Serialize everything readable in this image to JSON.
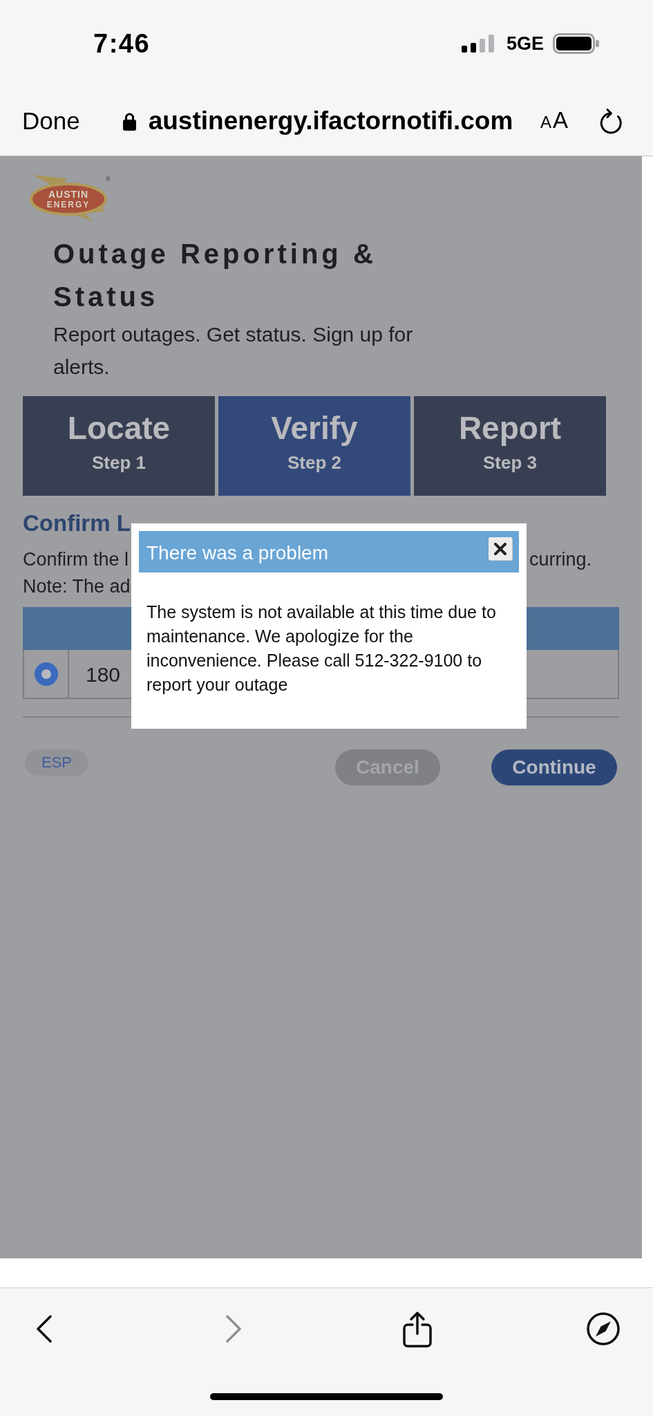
{
  "status_bar": {
    "time": "7:46",
    "network": "5GE"
  },
  "browser_bar": {
    "done": "Done",
    "url": "austinenergy.ifactornotifi.com",
    "text_size": "AA"
  },
  "page": {
    "logo": {
      "lines": [
        "AUSTIN",
        "ENERGY"
      ],
      "mark": "®"
    },
    "title": "Outage Reporting & Status",
    "subtitle": "Report outages. Get status. Sign up for alerts.",
    "steps": [
      {
        "label": "Locate",
        "step": "Step 1",
        "selected": false
      },
      {
        "label": "Verify",
        "step": "Step 2",
        "selected": true
      },
      {
        "label": "Report",
        "step": "Step 3",
        "selected": false
      }
    ],
    "heading": "Confirm L",
    "instructions": [
      {
        "left": "Confirm the l",
        "right": "curring."
      },
      {
        "left": "Note: The ad"
      }
    ],
    "table": {
      "rows": [
        {
          "selected": true,
          "cell_2": "180"
        }
      ]
    },
    "buttons": [
      {
        "label": "ESP",
        "kind": "language"
      },
      {
        "label": "Cancel",
        "kind": "secondary"
      },
      {
        "label": "Continue",
        "kind": "primary"
      }
    ]
  },
  "dialog": {
    "title": "There was a problem",
    "message": "The system is not available at this time due to maintenance. We apologize for the inconvenience. Please call 512-322-9100 to report your outage"
  },
  "toolbar": {
    "buttons": [
      {
        "kind": "back",
        "disabled": false
      },
      {
        "kind": "forward",
        "disabled": true
      },
      {
        "kind": "share",
        "disabled": false
      },
      {
        "kind": "compass",
        "disabled": false
      }
    ]
  }
}
